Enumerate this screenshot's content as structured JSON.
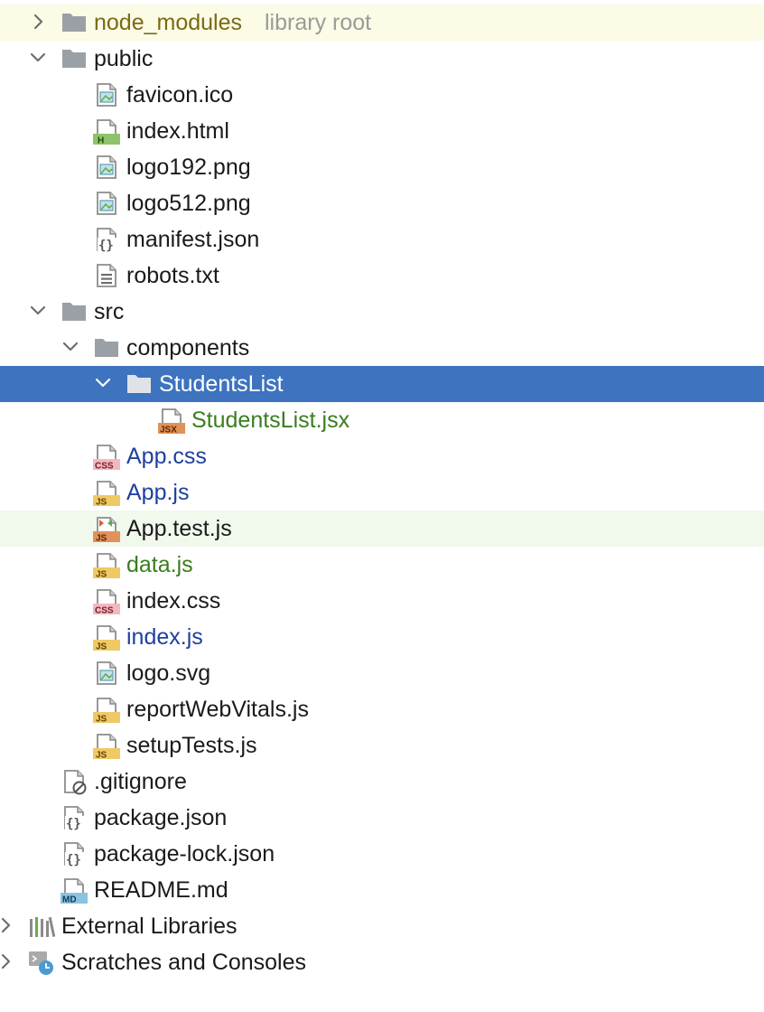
{
  "tree": {
    "node_modules": {
      "name": "node_modules",
      "hint": "library root"
    },
    "public": {
      "name": "public",
      "files": {
        "favicon": "favicon.ico",
        "index_html": "index.html",
        "logo192": "logo192.png",
        "logo512": "logo512.png",
        "manifest": "manifest.json",
        "robots": "robots.txt"
      }
    },
    "src": {
      "name": "src",
      "components": {
        "name": "components",
        "students_list": {
          "name": "StudentsList",
          "files": {
            "students_list_jsx": "StudentsList.jsx"
          }
        }
      },
      "files": {
        "app_css": "App.css",
        "app_js": "App.js",
        "app_test": "App.test.js",
        "data_js": "data.js",
        "index_css": "index.css",
        "index_js": "index.js",
        "logo_svg": "logo.svg",
        "report_web_vitals": "reportWebVitals.js",
        "setup_tests": "setupTests.js"
      }
    },
    "root_files": {
      "gitignore": ".gitignore",
      "package_json": "package.json",
      "package_lock": "package-lock.json",
      "readme": "README.md"
    },
    "external_libraries": "External Libraries",
    "scratches": "Scratches and Consoles"
  },
  "badges": {
    "html": "H",
    "jsx": "JSX",
    "css": "CSS",
    "js": "JS",
    "md": "MD"
  },
  "icons": {
    "folder": "folder-icon",
    "image_file": "image-file-icon",
    "html_file": "html-file-icon",
    "json_file": "json-file-icon",
    "text_file": "text-file-icon",
    "jsx_file": "jsx-file-icon",
    "css_file": "css-file-icon",
    "js_file": "js-file-icon",
    "test_file": "test-js-file-icon",
    "ignore_file": "gitignore-file-icon",
    "markdown_file": "markdown-file-icon",
    "libraries": "libraries-icon",
    "scratches": "scratches-icon"
  },
  "colors": {
    "selection": "#3d73bf",
    "excluded_row": "#fbfbe6",
    "test_row": "#f1f8ec",
    "modified_text": "#1f3f9e",
    "added_text": "#3a7d1e",
    "excluded_text": "#7a6a14"
  }
}
